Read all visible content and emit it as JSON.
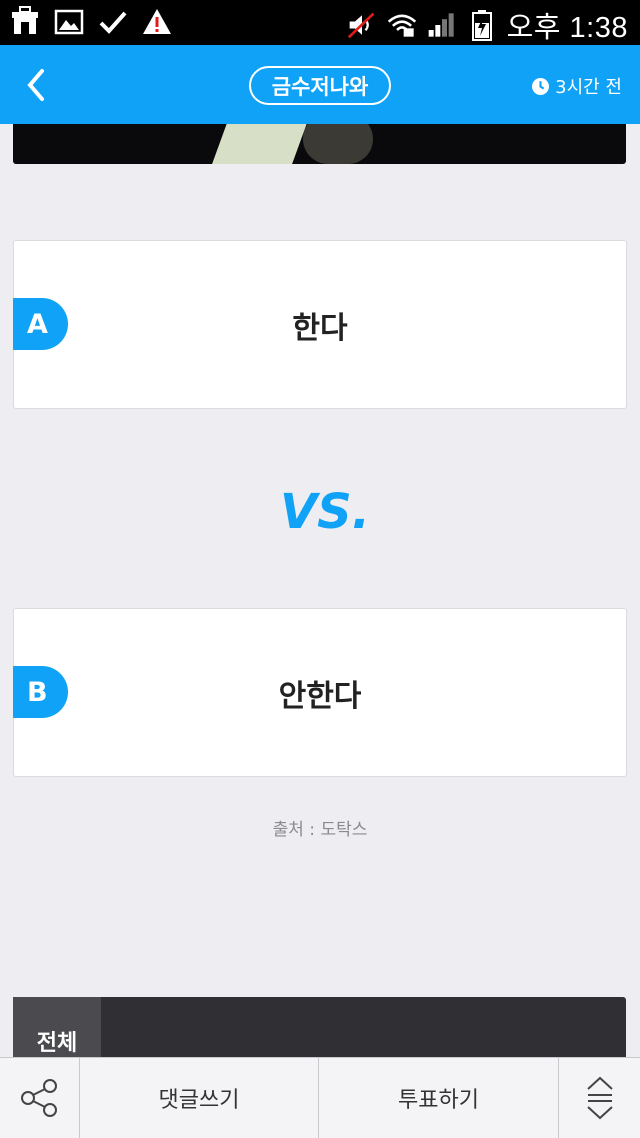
{
  "status_bar": {
    "time": "오후 1:38",
    "icons": [
      "store-icon",
      "gallery-icon",
      "check-icon",
      "warning-icon",
      "mute-icon",
      "wifi-icon",
      "signal-icon",
      "battery-icon"
    ]
  },
  "header": {
    "title": "금수저나와",
    "time_ago": "3시간 전",
    "accent_color": "#0fa2f7"
  },
  "options": [
    {
      "badge": "A",
      "label": "한다"
    },
    {
      "badge": "B",
      "label": "안한다"
    }
  ],
  "vs_label": "VS.",
  "source": "출처 : 도탁스",
  "comments": {
    "tab_all": "전체"
  },
  "toolbar": {
    "comment_label": "댓글쓰기",
    "vote_label": "투표하기"
  }
}
